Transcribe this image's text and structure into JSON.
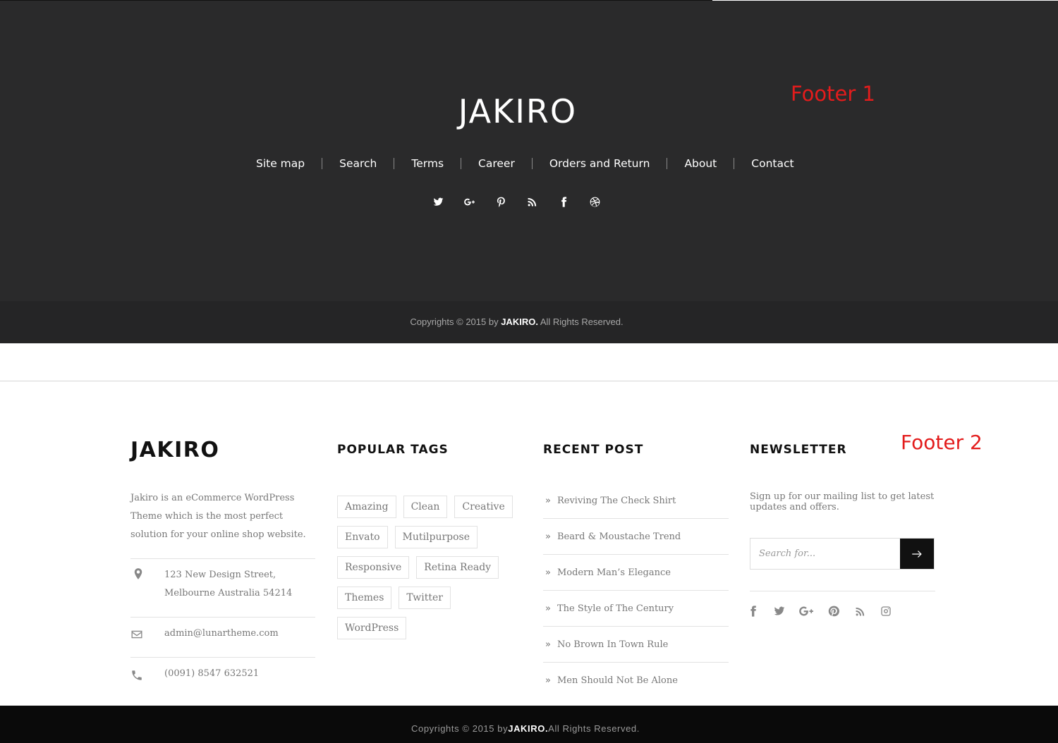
{
  "footer1": {
    "label": "Footer 1",
    "logo": "JAKIRO",
    "nav": [
      "Site map",
      "Search",
      "Terms",
      "Career",
      "Orders and Return",
      "About",
      "Contact"
    ],
    "social_icons": [
      "twitter-icon",
      "google-plus-icon",
      "pinterest-icon",
      "rss-icon",
      "facebook-icon",
      "dribbble-icon"
    ],
    "copyright_prefix": "Copyrights © 2015 by ",
    "copyright_brand": "JAKIRO.",
    "copyright_suffix": " All Rights Reserved."
  },
  "footer2": {
    "label": "Footer 2",
    "logo": "JAKIRO",
    "about_text": "Jakiro is an eCommerce WordPress Theme which is the most perfect solution for your online shop website.",
    "address_line1": "123 New Design Street,",
    "address_line2": "Melbourne Australia 54214",
    "email": "admin@lunartheme.com",
    "phone": "(0091) 8547 632521",
    "tags_title": "POPULAR TAGS",
    "tags": [
      "Amazing",
      "Clean",
      "Creative",
      "Envato",
      "Mutilpurpose",
      "Responsive",
      "Retina Ready",
      "Themes",
      "Twitter",
      "WordPress"
    ],
    "recent_title": "RECENT POST",
    "posts": [
      "Reviving The Check Shirt",
      "Beard & Moustache Trend",
      "Modern Man’s Elegance",
      "The Style of The Century",
      "No Brown In Town Rule",
      "Men Should Not Be Alone"
    ],
    "newsletter_title": "NEWSLETTER",
    "newsletter_text": "Sign up for our mailing list to get latest updates and offers.",
    "search_placeholder": "Search for...",
    "social_icons": [
      "facebook-icon",
      "twitter-icon",
      "google-plus-icon",
      "pinterest-icon",
      "rss-icon",
      "instagram-icon"
    ],
    "copyright_prefix": "Copyrights © 2015 by",
    "copyright_brand": "JAKIRO.",
    "copyright_suffix": "All Rights Reserved."
  },
  "colors": {
    "footer1_bg": "#2a2a2b",
    "footer2_bottom_bg": "#0a0a0a",
    "annotation_red": "#e31c1c"
  }
}
